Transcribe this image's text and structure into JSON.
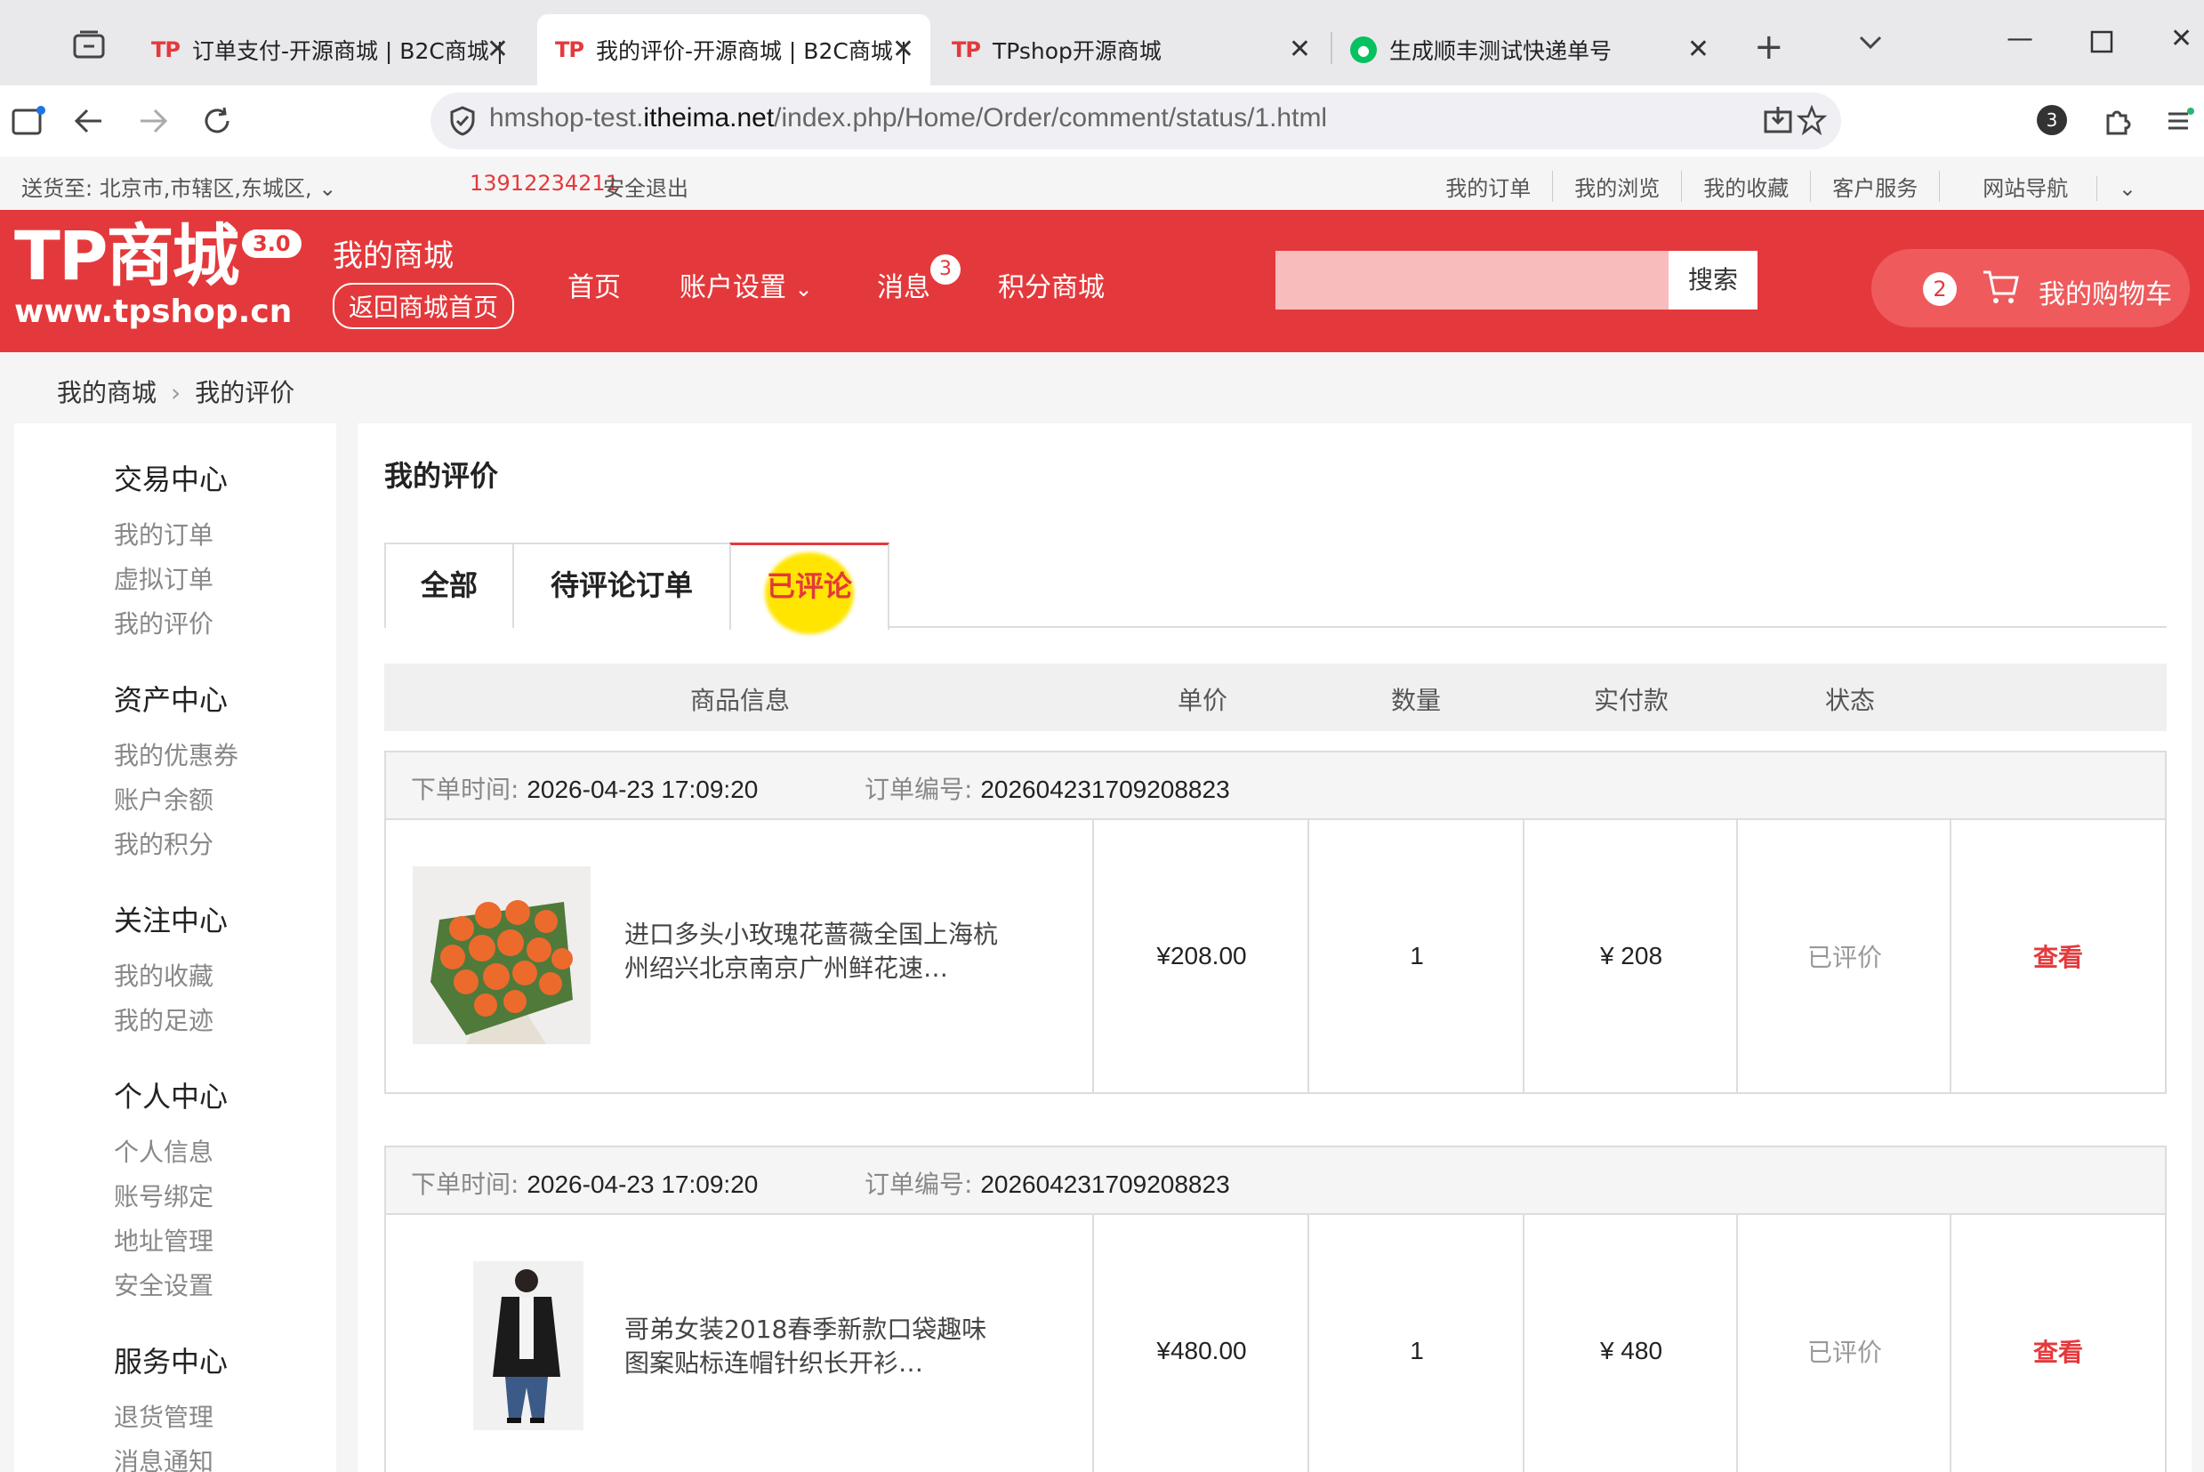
{
  "browser": {
    "tabs": [
      {
        "logo": "TP",
        "title": "订单支付-开源商城 | B2C商城 |"
      },
      {
        "logo": "TP",
        "title": "我的评价-开源商城 | B2C商城 |"
      },
      {
        "logo": "TP",
        "title": "TPshop开源商城"
      },
      {
        "logo": "",
        "title": "生成顺丰测试快递单号"
      }
    ],
    "url_prefix": "hmshop-test.",
    "url_domain": "itheima.net",
    "url_path": "/index.php/Home/Order/comment/status/1.html",
    "extensions_badge": "3",
    "accent": "#e4393c"
  },
  "sitetop": {
    "ship_to": "送货至:   北京市,市辖区,东城区,",
    "phone": "13912234211",
    "logout": "安全退出",
    "links": [
      "我的订单",
      "我的浏览",
      "我的收藏",
      "客户服务",
      "网站导航"
    ]
  },
  "header": {
    "brand": "TP商城",
    "version": "3.0",
    "site": "www.tpshop.cn",
    "mymall": "我的商城",
    "back_home": "返回商城首页",
    "nav": [
      "首页",
      "账户设置",
      "消息",
      "积分商城"
    ],
    "message_count": "3",
    "search_button": "搜索",
    "cart_count": "2",
    "cart_label": "我的购物车"
  },
  "breadcrumb": [
    "我的商城",
    "我的评价"
  ],
  "sidebar": {
    "groups": [
      {
        "title": "交易中心",
        "items": [
          "我的订单",
          "虚拟订单",
          "我的评价"
        ]
      },
      {
        "title": "资产中心",
        "items": [
          "我的优惠券",
          "账户余额",
          "我的积分"
        ]
      },
      {
        "title": "关注中心",
        "items": [
          "我的收藏",
          "我的足迹"
        ]
      },
      {
        "title": "个人中心",
        "items": [
          "个人信息",
          "账号绑定",
          "地址管理",
          "安全设置"
        ]
      },
      {
        "title": "服务中心",
        "items": [
          "退货管理",
          "消息通知"
        ]
      }
    ]
  },
  "main": {
    "title": "我的评价",
    "tabs": [
      "全部",
      "待评论订单",
      "已评论"
    ],
    "columns": [
      "商品信息",
      "单价",
      "数量",
      "实付款",
      "状态"
    ],
    "orders": [
      {
        "time_label": "下单时间:",
        "time": "2026-04-23 17:09:20",
        "no_label": "订单编号:",
        "no": "202604231709208823",
        "product": "进口多头小玫瑰花蔷薇全国上海杭州绍兴北京南京广州鲜花速…",
        "price": "¥208.00",
        "qty": "1",
        "paid": "¥ 208",
        "status": "已评价",
        "action": "查看"
      },
      {
        "time_label": "下单时间:",
        "time": "2026-04-23 17:09:20",
        "no_label": "订单编号:",
        "no": "202604231709208823",
        "product": "哥弟女装2018春季新款口袋趣味图案贴标连帽针织长开衫…",
        "price": "¥480.00",
        "qty": "1",
        "paid": "¥ 480",
        "status": "已评价",
        "action": "查看"
      }
    ]
  }
}
